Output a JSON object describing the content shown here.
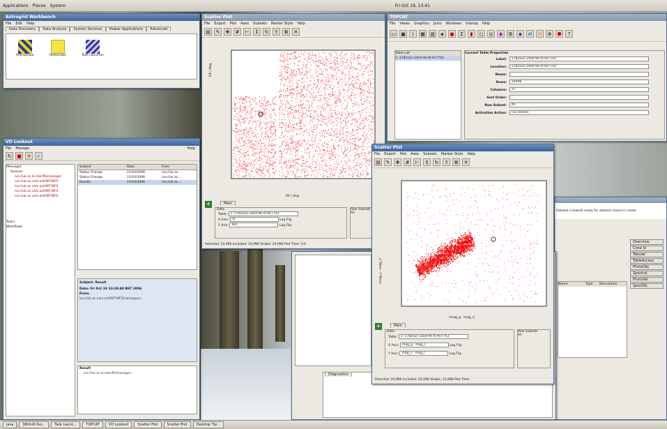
{
  "topbar": {
    "items": [
      "Applications",
      "Places",
      "System"
    ],
    "clock": "Fri Oct 19, 13:41"
  },
  "workbench": {
    "title": "Astrogrid Workbench",
    "menu": [
      "File",
      "Edit",
      "Help"
    ],
    "tabs": [
      "Data Discovery",
      "Data Analysis",
      "System Services",
      "Helper Applications",
      "Advanced"
    ],
    "apps": [
      "AstroScope",
      "Helioscope",
      "Task Launcher"
    ]
  },
  "vo": {
    "title": "VO Lookout",
    "menu": [
      "File",
      "Manage"
    ],
    "help": "Help",
    "tree": [
      "Messages",
      "Queries",
      "Tasks",
      "Workflows"
    ],
    "cols": [
      "Subject",
      "Date",
      "From"
    ],
    "rows": [
      [
        "Status Change",
        "21/10/2006",
        "ivo://uk.ac..."
      ],
      [
        "Status Change",
        "21/10/2006",
        "ivo://uk.ac..."
      ],
      [
        "Results",
        "21/10/2006",
        "ivo://uk.ac..."
      ]
    ],
    "detail": [
      "Subject: Result",
      "Date: Fri Oct 19 13:29:48 BST 2006",
      "From:"
    ],
    "result_label": "Result"
  },
  "scatter1": {
    "title": "Scatter Plot",
    "menu": [
      "File",
      "Export",
      "Plot",
      "Axes",
      "Subsets",
      "Marker Style",
      "Help"
    ],
    "ylabel": "DE / deg",
    "xlabel": "RA / deg",
    "main_tab": "Main",
    "data_label": "Data",
    "table_label": "Table:",
    "table_value": "1: 1782e2c-24e4-9e70-9c7743",
    "x_axis_label": "X Axis:",
    "x_axis_value": "ra",
    "y_axis_label": "Y Axis:",
    "y_axis_value": "dec",
    "log": "Log",
    "flip": "Flip",
    "row_subsets": "Row Subsets",
    "all": "All",
    "status": "Potential: 24,996  Included: 24,996  Visible: 24,996  Plot Time: 0.0"
  },
  "topcat": {
    "title": "TOPCAT",
    "menu": [
      "File",
      "Views",
      "Graphics",
      "Joins",
      "Windows",
      "Interop",
      "Help"
    ],
    "list_title": "Table List",
    "list_item": "1: 1782e2c-24e4-9e70-9c7743",
    "props_title": "Current Table Properties",
    "labels": [
      "Label:",
      "Location:",
      "Name:",
      "Rows:",
      "Columns:",
      "Sort Order:",
      "Row Subset:",
      "Activation Action:"
    ],
    "values": [
      "1782e2c-24e4-9e70-9c7743",
      "1782e2c-24e4-9e70-9c7743",
      "",
      "24996",
      "27",
      "",
      "All",
      "(no action)"
    ]
  },
  "scatter2": {
    "title": "Scatter Plot",
    "menu": [
      "File",
      "Export",
      "Plot",
      "Axes",
      "Subsets",
      "Marker Style",
      "Help"
    ],
    "ylabel": "(mag_v - mag_r)",
    "xlabel": "(mag_g - mag_r)",
    "main_tab": "Main",
    "data_label": "Data",
    "table_label": "Table:",
    "table_value": "1: 1782e2c-24e4-9e70-9c7743",
    "x_axis_label": "X Axis:",
    "x_axis_value": "mag_g - mag_r",
    "y_axis_label": "Y Axis:",
    "y_axis_value": "mag_v - mag_r",
    "log": "Log",
    "flip": "Flip",
    "row_subsets": "Row Subsets",
    "all": "All",
    "status": "Potential: 24,996  Included: 24,996  Visible: 23,988  Plot Time:"
  },
  "backwin": {
    "tip": "Dataset (viewed) ready for dataset column's made",
    "list": [
      "Overview",
      "Cone Sr",
      "Tabular",
      "TableAccess",
      "PhotoObj",
      "Spectral",
      "PhotoVal",
      "SpecObj"
    ],
    "diag": "Diagnostics",
    "cols": [
      "Name",
      "Type",
      "Description"
    ]
  },
  "taskbar": {
    "items": [
      "java",
      "[Wimdt-Sur...",
      "Task Launc...",
      "TOPCAT",
      "VO Lookout",
      "Scatter Plot",
      "Scatter Plot",
      "Desktop Tip..."
    ]
  }
}
